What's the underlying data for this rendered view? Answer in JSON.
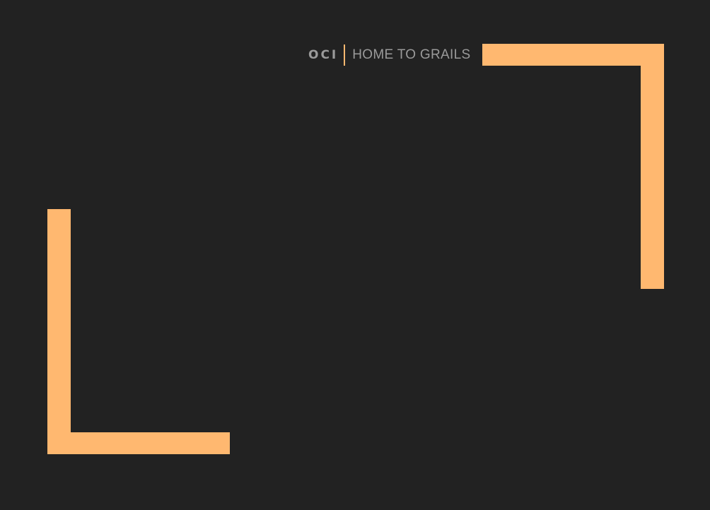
{
  "brand": {
    "logo": "OCI",
    "tagline": "HOME TO GRAILS"
  },
  "colors": {
    "background": "#222222",
    "accent": "#FFB870",
    "text": "#9a9a9a"
  }
}
